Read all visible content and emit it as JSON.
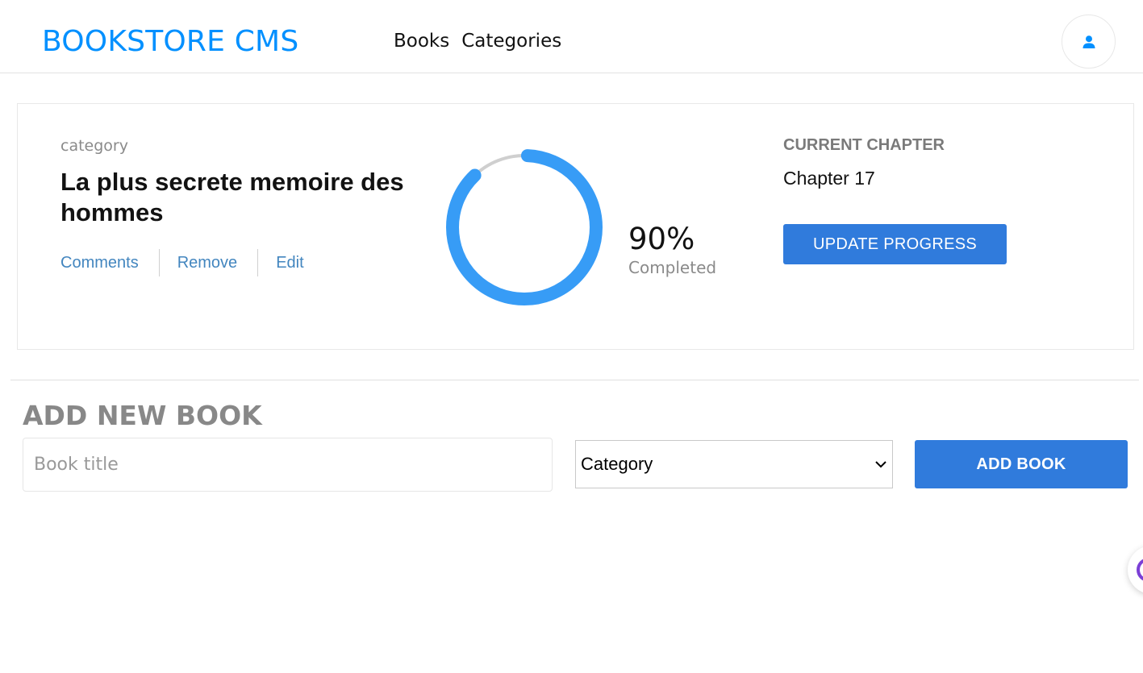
{
  "header": {
    "brand": "BOOKSTORE CMS",
    "nav": [
      "Books",
      "Categories"
    ],
    "user_icon": "user-icon"
  },
  "book": {
    "category": "category",
    "title": "La plus secrete memoire des hommes",
    "actions": [
      "Comments",
      "Remove",
      "Edit"
    ],
    "progress_percent": 90,
    "progress_label": "90%",
    "completed_label": "Completed",
    "current_chapter_label": "CURRENT CHAPTER",
    "current_chapter": "Chapter 17",
    "update_button": "UPDATE PROGRESS"
  },
  "form": {
    "title": "ADD NEW BOOK",
    "title_placeholder": "Book title",
    "category_value": "Category",
    "add_button": "ADD BOOK"
  },
  "colors": {
    "brand": "#0290ff",
    "accent": "#307bdc",
    "progress": "#379cf6",
    "link": "#4386bf"
  }
}
